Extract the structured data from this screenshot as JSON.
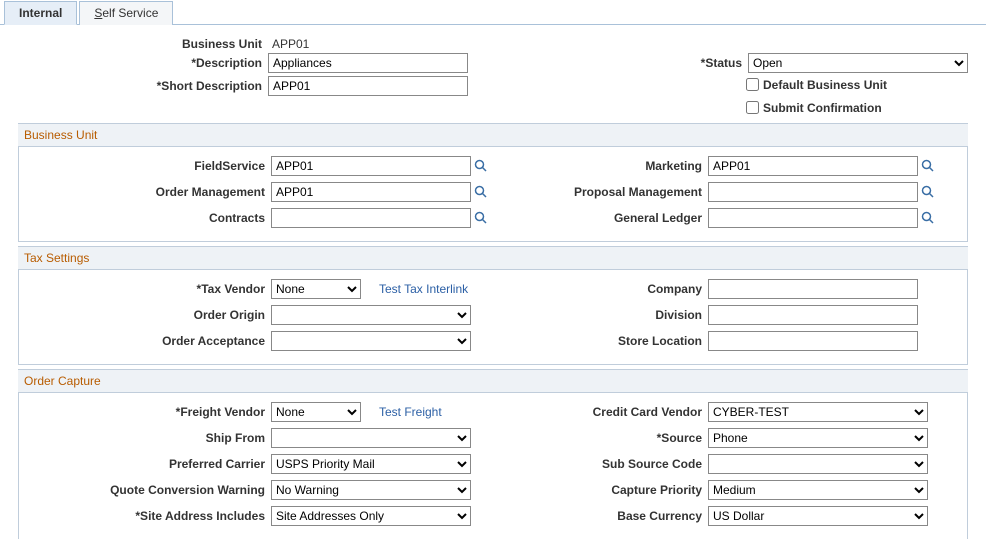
{
  "tabs": {
    "internal": "Internal",
    "self_service_prefix": "S",
    "self_service_rest": "elf Service"
  },
  "header": {
    "business_unit_label": "Business Unit",
    "business_unit_value": "APP01",
    "description_label": "*Description",
    "description_value": "Appliances",
    "short_description_label": "*Short Description",
    "short_description_value": "APP01",
    "status_label": "*Status",
    "status_value": "Open",
    "default_bu_label": "Default Business Unit",
    "submit_confirmation_label": "Submit Confirmation"
  },
  "bu_section": {
    "title": "Business Unit",
    "field_service_label": "FieldService",
    "field_service_value": "APP01",
    "order_management_label": "Order Management",
    "order_management_value": "APP01",
    "contracts_label": "Contracts",
    "contracts_value": "",
    "marketing_label": "Marketing",
    "marketing_value": "APP01",
    "proposal_management_label": "Proposal Management",
    "proposal_management_value": "",
    "general_ledger_label": "General Ledger",
    "general_ledger_value": ""
  },
  "tax_section": {
    "title": "Tax Settings",
    "tax_vendor_label": "*Tax Vendor",
    "tax_vendor_value": "None",
    "test_tax_link": "Test Tax Interlink",
    "order_origin_label": "Order Origin",
    "order_origin_value": "",
    "order_acceptance_label": "Order Acceptance",
    "order_acceptance_value": "",
    "company_label": "Company",
    "company_value": "",
    "division_label": "Division",
    "division_value": "",
    "store_location_label": "Store Location",
    "store_location_value": ""
  },
  "oc_section": {
    "title": "Order Capture",
    "freight_vendor_label": "*Freight Vendor",
    "freight_vendor_value": "None",
    "test_freight_link": "Test Freight",
    "ship_from_label": "Ship From",
    "ship_from_value": "",
    "preferred_carrier_label": "Preferred Carrier",
    "preferred_carrier_value": "USPS Priority Mail",
    "quote_conv_label": "Quote Conversion Warning",
    "quote_conv_value": "No Warning",
    "site_addr_label": "*Site Address Includes",
    "site_addr_value": "Site Addresses Only",
    "credit_card_label": "Credit Card Vendor",
    "credit_card_value": "CYBER-TEST",
    "source_label": "*Source",
    "source_value": "Phone",
    "sub_source_label": "Sub Source Code",
    "sub_source_value": "",
    "capture_priority_label": "Capture Priority",
    "capture_priority_value": "Medium",
    "base_currency_label": "Base Currency",
    "base_currency_value": "US Dollar"
  }
}
